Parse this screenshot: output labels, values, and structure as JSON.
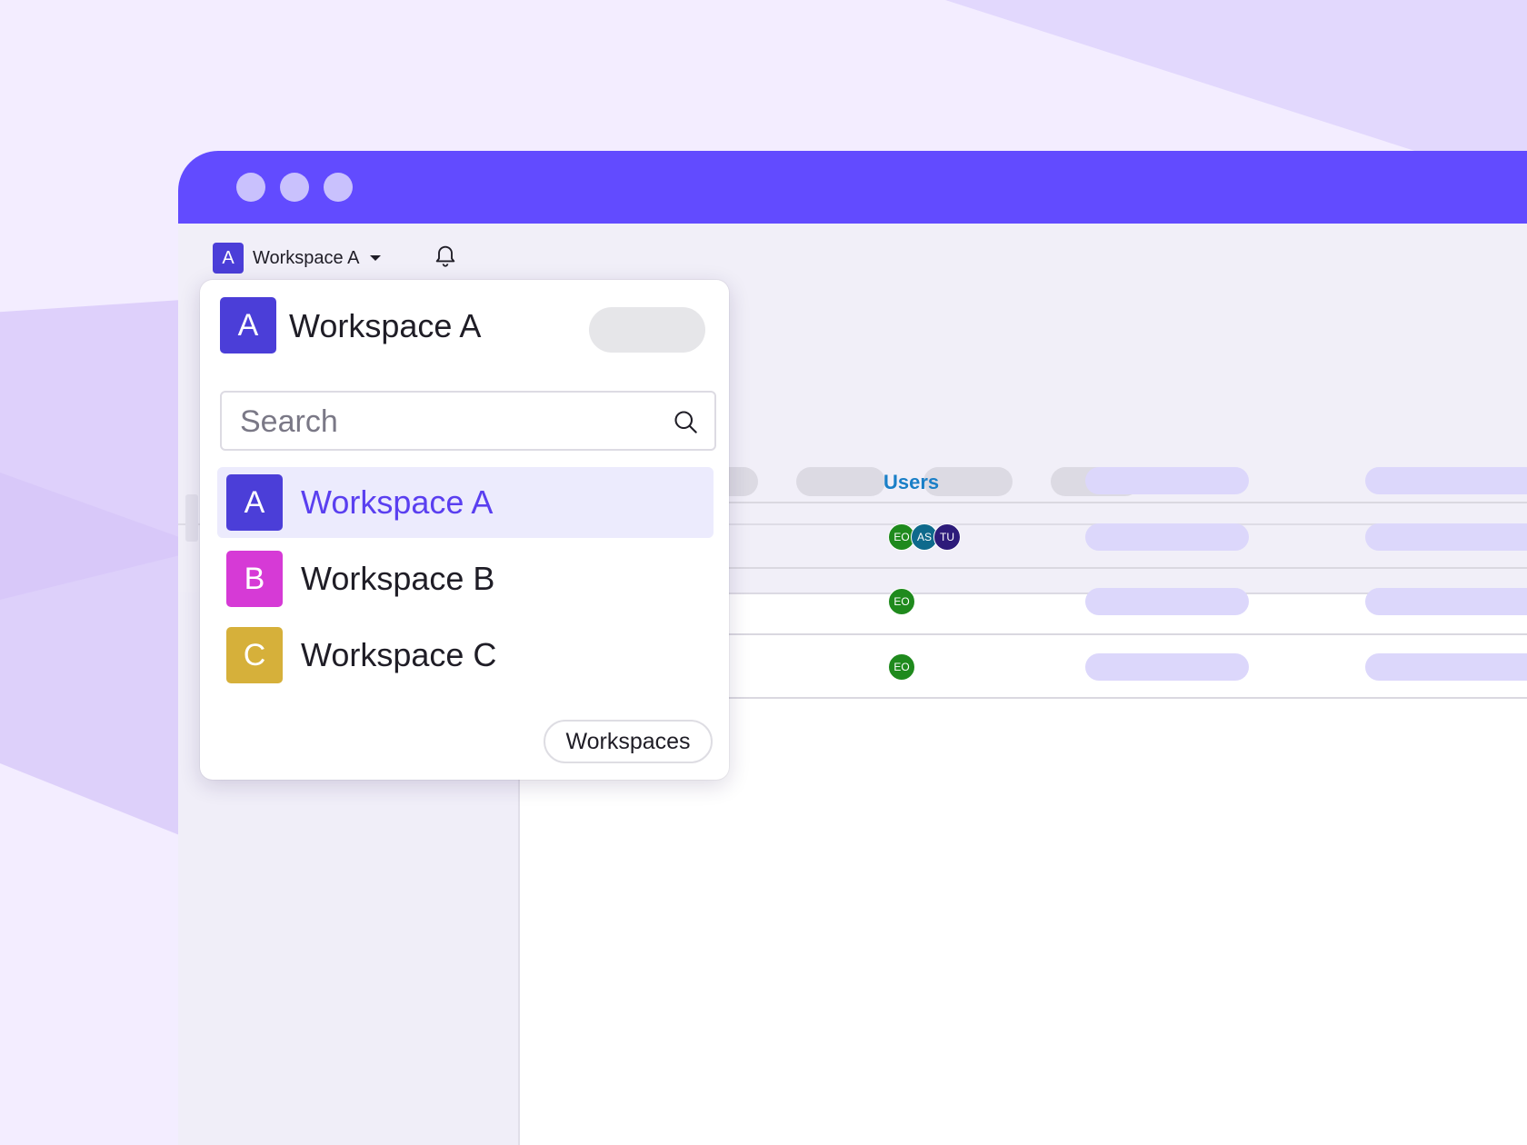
{
  "topbar": {
    "workspace_initial": "A",
    "workspace_name": "Workspace A"
  },
  "table": {
    "users_header": "Users",
    "rows": [
      {
        "avatars": [
          {
            "initials": "EO",
            "color": "#1f8a1d"
          },
          {
            "initials": "AS",
            "color": "#0f6a8c"
          },
          {
            "initials": "TU",
            "color": "#2d1b7a"
          }
        ]
      },
      {
        "avatars": [
          {
            "initials": "EO",
            "color": "#1f8a1d"
          }
        ]
      },
      {
        "avatars": [
          {
            "initials": "EO",
            "color": "#1f8a1d"
          }
        ]
      }
    ]
  },
  "dropdown": {
    "current": {
      "initial": "A",
      "name": "Workspace A"
    },
    "search": {
      "placeholder": "Search",
      "value": ""
    },
    "workspaces": [
      {
        "initial": "A",
        "name": "Workspace A",
        "color": "#4b3ed8",
        "selected": true
      },
      {
        "initial": "B",
        "name": "Workspace B",
        "color": "#d63ad6",
        "selected": false
      },
      {
        "initial": "C",
        "name": "Workspace C",
        "color": "#d6b03a",
        "selected": false
      }
    ],
    "footer_button": "Workspaces"
  },
  "colors": {
    "brand": "#624bff",
    "accent": "#5a3ff0",
    "users_header": "#1a7fc7"
  },
  "icons": {
    "notifications": "bell-icon",
    "search": "search-icon",
    "workspace_menu": "caret-down-icon"
  }
}
